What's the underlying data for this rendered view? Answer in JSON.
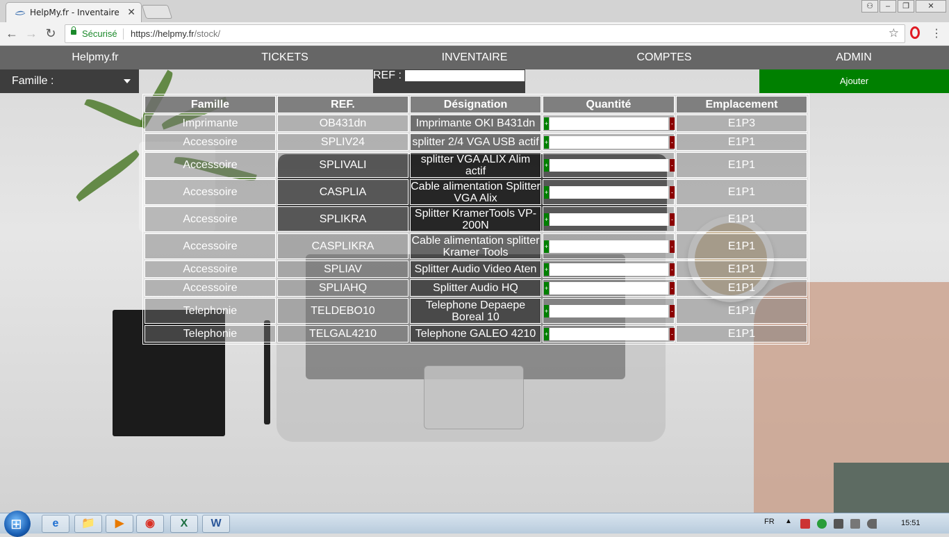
{
  "browser": {
    "tab_title": "HelpMy.fr - Inventaire",
    "tab_close": "✕",
    "secure_label": "Sécurisé",
    "url_base": "https://helpmy.fr",
    "url_path": "/stock/",
    "back": "←",
    "forward": "→",
    "reload": "↻",
    "star": "☆",
    "menu": "⋮",
    "window_buttons": [
      "⚇",
      "–",
      "❐",
      "✕"
    ]
  },
  "nav": {
    "brand": "Helpmy.fr",
    "items": [
      "TICKETS",
      "INVENTAIRE",
      "COMPTES",
      "ADMIN"
    ]
  },
  "filters": {
    "famille_label": "Famille :",
    "ref_label": "REF :",
    "ref_value": "",
    "add_label": "Ajouter"
  },
  "table": {
    "headers": [
      "Famille",
      "REF.",
      "Désignation",
      "Quantité",
      "Emplacement"
    ],
    "plus": "+",
    "minus": "-",
    "rows": [
      {
        "famille": "Imprimante",
        "ref": "OB431dn",
        "designation": "Imprimante OKI B431dn",
        "emplacement": "E1P3"
      },
      {
        "famille": "Accessoire",
        "ref": "SPLIV24",
        "designation": "splitter 2/4 VGA USB actif",
        "emplacement": "E1P1"
      },
      {
        "famille": "Accessoire",
        "ref": "SPLIVALI",
        "designation": "splitter VGA ALIX Alim actif",
        "emplacement": "E1P1"
      },
      {
        "famille": "Accessoire",
        "ref": "CASPLIA",
        "designation": "Cable alimentation Splitter VGA Alix",
        "emplacement": "E1P1"
      },
      {
        "famille": "Accessoire",
        "ref": "SPLIKRA",
        "designation": "Splitter KramerTools VP-200N",
        "emplacement": "E1P1"
      },
      {
        "famille": "Accessoire",
        "ref": "CASPLIKRA",
        "designation": "Cable alimentation splitter Kramer Tools",
        "emplacement": "E1P1"
      },
      {
        "famille": "Accessoire",
        "ref": "SPLIAV",
        "designation": "Splitter Audio Video Aten",
        "emplacement": "E1P1"
      },
      {
        "famille": "Accessoire",
        "ref": "SPLIAHQ",
        "designation": "Splitter Audio HQ",
        "emplacement": "E1P1"
      },
      {
        "famille": "Telephonie",
        "ref": "TELDEBO10",
        "designation": "Telephone Depaepe Boreal 10",
        "emplacement": "E1P1"
      },
      {
        "famille": "Telephonie",
        "ref": "TELGAL4210",
        "designation": "Telephone GALEO 4210",
        "emplacement": "E1P1"
      }
    ]
  },
  "taskbar": {
    "apps": [
      "e",
      "📁",
      "▶",
      "◉",
      "X",
      "W"
    ],
    "lang": "FR",
    "tray_up": "▲",
    "time": "15:51"
  },
  "colors": {
    "nav_bg": "#666666",
    "add_button": "#008000",
    "plus_button": "#008000",
    "minus_button": "#8b0000"
  }
}
